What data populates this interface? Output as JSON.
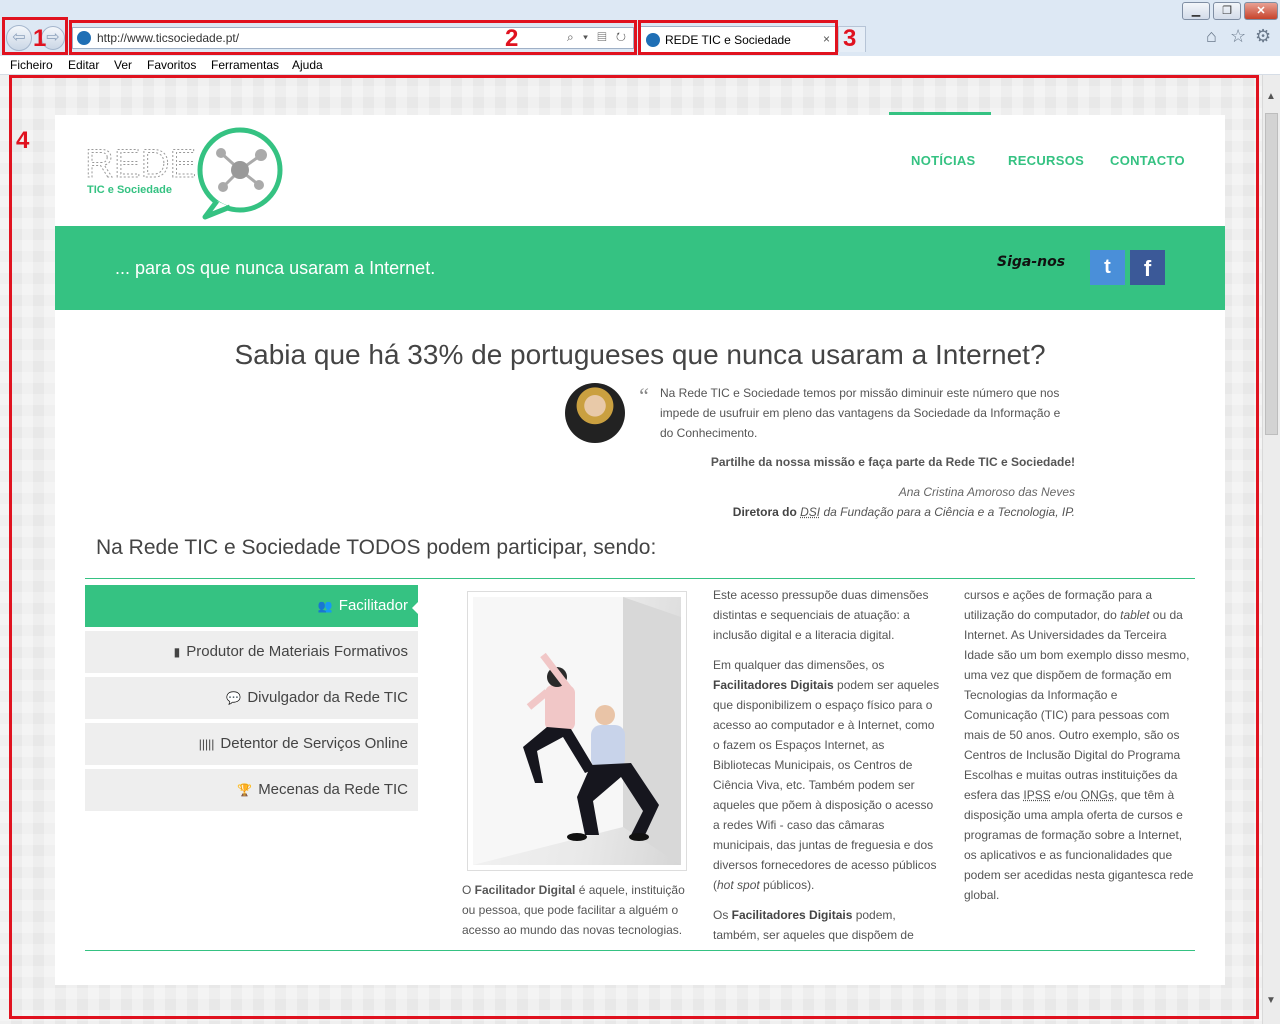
{
  "browser": {
    "window_controls": {
      "minimize": "▁",
      "maximize": "❐",
      "close": "✕"
    },
    "address_url": "http://www.ticsociedade.pt/",
    "address_tools": "⌕ ▾ ▤ ↻",
    "tab_title": "REDE TIC e Sociedade",
    "tab_close": "×",
    "menu": [
      "Ficheiro",
      "Editar",
      "Ver",
      "Favoritos",
      "Ferramentas",
      "Ajuda"
    ],
    "icons": {
      "back": "back-arrow-icon",
      "forward": "forward-arrow-icon",
      "home": "home-icon",
      "favorites": "star-icon",
      "tools": "gear-icon"
    }
  },
  "callouts": [
    "1",
    "2",
    "3",
    "4"
  ],
  "site": {
    "logo": {
      "word": "REDE",
      "sub": "TIC e Sociedade"
    },
    "nav": [
      "NOTÍCIAS",
      "RECURSOS",
      "CONTACTO"
    ],
    "tagline": "... para os que nunca usaram a Internet.",
    "follow": "Siga-nos",
    "social": {
      "twitter": "t",
      "facebook": "f"
    },
    "headline": "Sabia que há 33% de portugueses que nunca usaram a Internet?",
    "quote": {
      "mark": "“",
      "text": "Na Rede TIC e Sociedade temos por missão diminuir este número que nos impede de usufruir em pleno das vantagens da Sociedade da Informação e do Conhecimento.",
      "bold": "Partilhe da nossa missão e faça parte da Rede TIC e Sociedade!",
      "author": "Ana Cristina Amoroso das Neves",
      "role_prefix": "Diretora do ",
      "role_abbr": "DSI",
      "role_suffix": " da Fundação para a Ciência e a Tecnologia, IP."
    },
    "section_title": "Na Rede TIC e Sociedade TODOS podem participar, sendo:",
    "tabs": [
      {
        "icon": "👥",
        "label": "Facilitador"
      },
      {
        "icon": "▮",
        "label": "Produtor de Materiais Formativos"
      },
      {
        "icon": "💬",
        "label": "Divulgador da Rede TIC"
      },
      {
        "icon": "|||||",
        "label": "Detentor de Serviços Online"
      },
      {
        "icon": "🏆",
        "label": "Mecenas da Rede TIC"
      }
    ],
    "caption": {
      "pre": "O ",
      "bold": "Facilitador Digital",
      "post": " é aquele, instituição ou pessoa, que pode facilitar a alguém o acesso ao mundo das novas tecnologias."
    },
    "col1": {
      "p1": "Este acesso pressupõe duas dimensões distintas e sequenciais de atuação: a inclusão digital e a literacia digital.",
      "p2_pre": "Em qualquer das dimensões, os ",
      "p2_bold": "Facilitadores Digitais",
      "p2_post": " podem ser aqueles que disponibilizem o espaço físico para o acesso ao computador e à Internet, como o fazem os Espaços Internet, as Bibliotecas Municipais, os Centros de Ciência Viva, etc. Também podem ser aqueles que põem à disposição o acesso a redes Wifi - caso das câmaras municipais, das juntas de freguesia e dos diversos fornecedores de acesso públicos (",
      "p2_italic": "hot spot",
      "p2_end": " públicos).",
      "p3_pre": "Os ",
      "p3_bold": "Facilitadores Digitais",
      "p3_post": " podem, também, ser aqueles que dispõem de"
    },
    "col2": {
      "t1": "cursos e ações de formação para a utilização do computador, do ",
      "t1_italic": "tablet",
      "t2": " ou da Internet. As Universidades da Terceira Idade são um bom exemplo disso mesmo, uma vez que dispõem de formação em Tecnologias da Informação e Comunicação (TIC) para pessoas com mais de 50 anos. Outro exemplo, são os Centros de Inclusão Digital do Programa Escolhas e muitas outras instituições da esfera das ",
      "abbr1": "IPSS",
      "t3": " e/ou ",
      "abbr2": "ONGs",
      "t4": ", que têm à disposição uma ampla oferta de cursos e programas de formação sobre a Internet, os aplicativos e as funcionalidades que podem ser acedidas nesta gigantesca rede global."
    },
    "colors": {
      "accent": "#35c282",
      "twitter": "#4a8fd9",
      "facebook": "#3b5998",
      "callout": "#e0121f"
    }
  }
}
